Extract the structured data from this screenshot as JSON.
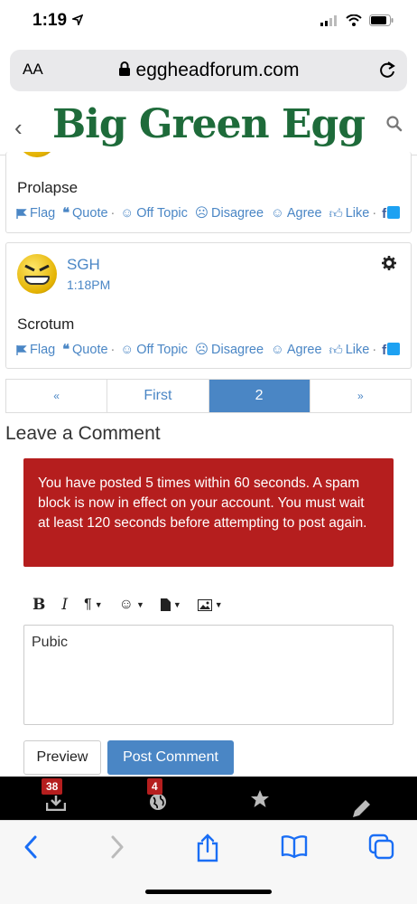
{
  "status_bar": {
    "time": "1:19"
  },
  "browser": {
    "aa_label": "AA",
    "url": "eggheadforum.com"
  },
  "site": {
    "logo": "Big Green Egg"
  },
  "comments": [
    {
      "body": "Prolapse",
      "reactions": {
        "flag": "Flag",
        "quote": "Quote",
        "off_topic": "Off Topic",
        "disagree": "Disagree",
        "agree": "Agree",
        "like": "Like"
      }
    },
    {
      "author": "SGH",
      "date": "1:18PM",
      "body": "Scrotum",
      "reactions": {
        "flag": "Flag",
        "quote": "Quote",
        "off_topic": "Off Topic",
        "disagree": "Disagree",
        "agree": "Agree",
        "like": "Like"
      }
    }
  ],
  "pager": {
    "prev": "«",
    "first": "First",
    "current": "2",
    "next": "»"
  },
  "comment_form": {
    "title": "Leave a Comment",
    "alert": "You have posted 5 times within 60 seconds. A spam block is now in effect on your account. You must wait at least 120 seconds before attempting to post again.",
    "toolbar": {
      "bold": "B",
      "italic": "I"
    },
    "editor_value": "Pubic",
    "preview_label": "Preview",
    "post_label": "Post Comment"
  },
  "bottom_nav": {
    "inbox_count": "38",
    "notifications_count": "4"
  },
  "colors": {
    "link": "#4a86c5",
    "alert_bg": "#b51e1e",
    "logo": "#1e6b3a"
  }
}
